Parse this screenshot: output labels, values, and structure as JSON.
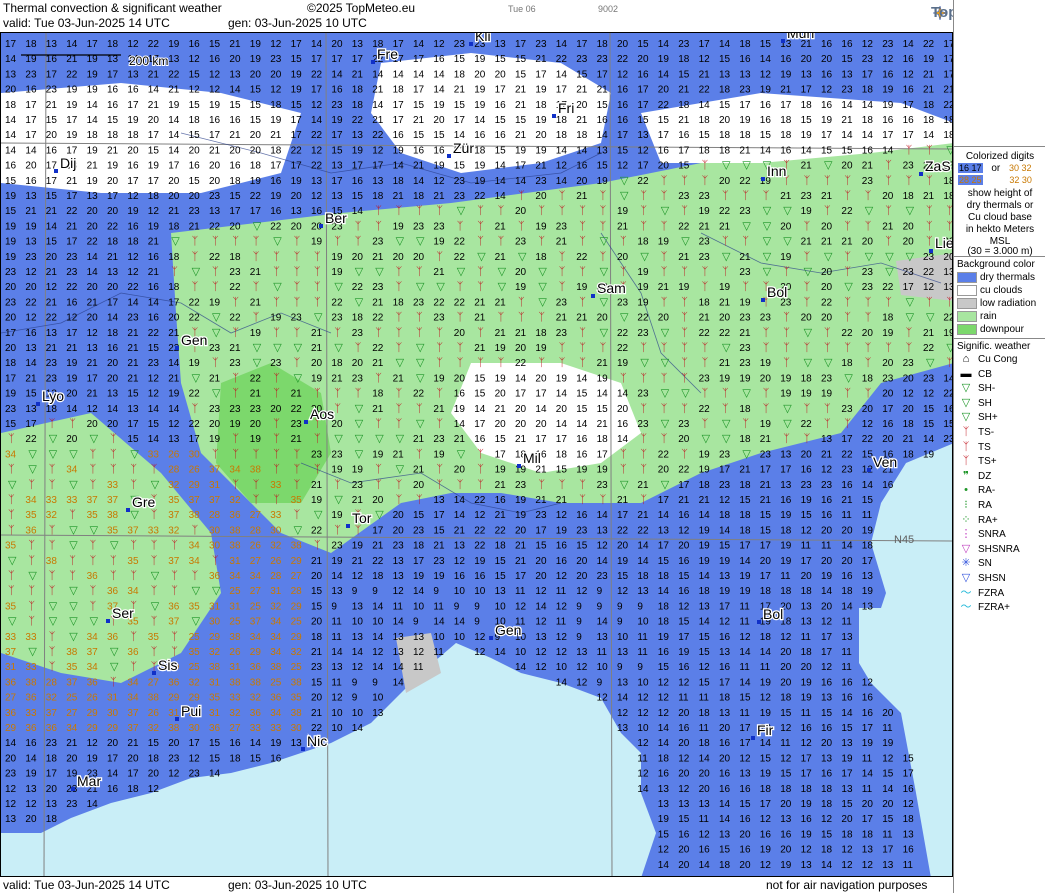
{
  "header": {
    "title": "Thermal convection & significant weather",
    "copyright": "©2025 TopMeteo.eu",
    "day": "Tue 06",
    "code": "9002",
    "valid": "valid:  Tue  03-Jun-2025  14 UTC",
    "gen": "gen: 03-Jun-2025 10 UTC",
    "logo": "TopMeteo"
  },
  "footer": {
    "valid": "valid:  Tue  03-Jun-2025  14 UTC",
    "gen": "gen: 03-Jun-2025 10 UTC",
    "disclaimer": "not for air navigation purposes"
  },
  "map": {
    "scale_label": "200 km",
    "grid_label": "N45",
    "cities": [
      "Dij",
      "Kli",
      "Mun",
      "Fre",
      "Fri",
      "Zür",
      "Inn",
      "ZaS",
      "Ber",
      "Lie",
      "Sam",
      "Bol",
      "Gen",
      "Lyo",
      "Aos",
      "Mil",
      "Ven",
      "Gre",
      "Tor",
      "Ser",
      "Gen",
      "Bol",
      "Sis",
      "Pui",
      "Nic",
      "Fir",
      "Mar"
    ],
    "colors": {
      "dry_thermals": "#5b7fe8",
      "cu_clouds": "#ffffff",
      "low_radiation": "#c8c8c8",
      "rain": "#a8e6a0",
      "downpour": "#7cd86c",
      "sea": "#c9eef7",
      "digit_dry": "#000000",
      "digit_cu_high": "#c87800",
      "ts_symbol": "#c0141e",
      "sh_symbol": "#1e9628"
    }
  },
  "legend": {
    "colorized_title": "Colorized digits",
    "example_a": "16 17",
    "example_b": "30 32",
    "example_or": "or",
    "example_c": "28 25",
    "example_d": "32 30",
    "desc1": "show height of",
    "desc2": "dry thermals or",
    "desc3": "Cu cloud base",
    "desc4": "in hekto Meters",
    "desc5": "MSL",
    "desc6": "(30 = 3.000 m)",
    "bg_title": "Background color",
    "bg_items": [
      "dry thermals",
      "cu clouds",
      "low radiation",
      "rain",
      "downpour"
    ],
    "sig_title": "Signific. weather",
    "sig_items": [
      "Cu Cong",
      "CB",
      "SH-",
      "SH",
      "SH+",
      "TS-",
      "TS",
      "TS+",
      "DZ",
      "RA-",
      "RA",
      "RA+",
      "SNRA",
      "SHSNRA",
      "SN",
      "SHSN",
      "FZRA",
      "FZRA+"
    ],
    "sig_icons": [
      "cu-cong-icon",
      "cb-icon",
      "shower-light-icon",
      "shower-icon",
      "shower-heavy-icon",
      "thunderstorm-light-icon",
      "thunderstorm-icon",
      "thunderstorm-heavy-icon",
      "drizzle-icon",
      "rain-light-icon",
      "rain-icon",
      "rain-heavy-icon",
      "snow-rain-icon",
      "snow-rain-shower-icon",
      "snow-icon",
      "snow-shower-icon",
      "freezing-rain-icon",
      "freezing-rain-heavy-icon"
    ]
  }
}
